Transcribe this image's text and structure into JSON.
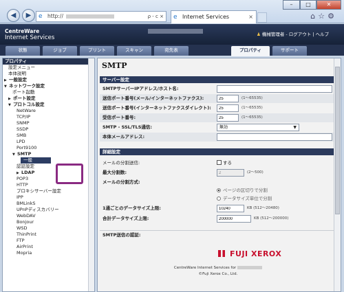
{
  "browser": {
    "url_prefix": "http://",
    "tab_title": "Internet Services",
    "tab_close": "×",
    "addr_tools": "ρ - c ×",
    "window_controls": [
      "–",
      "□",
      "✕"
    ]
  },
  "header": {
    "brand_line1": "CentreWare",
    "brand_line2": "Internet Services",
    "user_text": "機械管理者 - ログアウト | ヘルプ"
  },
  "nav_tabs": [
    {
      "label": "状態"
    },
    {
      "label": "ジョブ"
    },
    {
      "label": "プリント"
    },
    {
      "label": "スキャン"
    },
    {
      "label": "宛先表"
    },
    {
      "label": "プロパティ"
    },
    {
      "label": "サポート"
    }
  ],
  "sidebar": {
    "header": "プロパティ",
    "items": [
      {
        "label": "設定メニュー",
        "tri": ""
      },
      {
        "label": "本体説明",
        "tri": ""
      },
      {
        "label": "一般設定",
        "tri": "▶"
      },
      {
        "label": "ネットワーク設定",
        "tri": "▼"
      },
      {
        "label": "ポート起動",
        "tri": ""
      },
      {
        "label": "ポート設定",
        "tri": "▶"
      },
      {
        "label": "プロトコル設定",
        "tri": "▼"
      },
      {
        "label": "NetWare",
        "tri": ""
      },
      {
        "label": "TCP/IP",
        "tri": ""
      },
      {
        "label": "SNMP",
        "tri": ""
      },
      {
        "label": "SSDP",
        "tri": ""
      },
      {
        "label": "SMB",
        "tri": ""
      },
      {
        "label": "LPD",
        "tri": ""
      },
      {
        "label": "Port9100",
        "tri": ""
      },
      {
        "label": "SMTP",
        "tri": "▼"
      },
      {
        "label": "一般",
        "tri": ""
      },
      {
        "label": "認証設定",
        "tri": ""
      },
      {
        "label": "LDAP",
        "tri": "▶"
      },
      {
        "label": "POP3",
        "tri": ""
      },
      {
        "label": "HTTP",
        "tri": ""
      },
      {
        "label": "プロキシサーバー設定",
        "tri": ""
      },
      {
        "label": "IPP",
        "tri": ""
      },
      {
        "label": "BMLinkS",
        "tri": ""
      },
      {
        "label": "UPnPディスカバリー",
        "tri": ""
      },
      {
        "label": "WebDAV",
        "tri": ""
      },
      {
        "label": "Bonjour",
        "tri": ""
      },
      {
        "label": "WSD",
        "tri": ""
      },
      {
        "label": "ThinPrint",
        "tri": ""
      },
      {
        "label": "FTP",
        "tri": ""
      },
      {
        "label": "AirPrint",
        "tri": ""
      },
      {
        "label": "Mopria",
        "tri": ""
      }
    ]
  },
  "content": {
    "title": "SMTP",
    "server_section": {
      "header": "サーバー設定",
      "server_name_label": "SMTPサーバーIPアドレス/ホスト名:",
      "server_name_value": "",
      "fax_port_label": "送信ポート番号(メール/インターネットファクス):",
      "fax_port_value": "25",
      "fax_port_hint": "(1〜65535)",
      "direct_port_label": "送信ポート番号(インターネットファクスダイレクト):",
      "direct_port_value": "25",
      "direct_port_hint": "(1〜65535)",
      "recv_port_label": "受信ポート番号:",
      "recv_port_value": "25",
      "recv_port_hint": "(1〜65535)",
      "ssl_label": "SMTP - SSL/TLS通信:",
      "ssl_value": "無効",
      "email_label": "本体メールアドレス:",
      "email_value": ""
    },
    "detail_section": {
      "header": "詳細設定",
      "split_label": "メールの分割送信:",
      "split_checkbox": "する",
      "max_split_label": "最大分割数:",
      "max_split_value": "2",
      "max_split_hint": "(2〜500)",
      "split_method_label": "メールの分割方式:",
      "radio_page": "ページの区切りで分割",
      "radio_size": "データサイズ単位で分割",
      "per_mail_label": "1通ごとのデータサイズ上限:",
      "per_mail_value": "10240",
      "per_mail_hint": "KB (512〜20480)",
      "total_label": "合計データサイズ上限:",
      "total_value": "200000",
      "total_hint": "KB (512〜200000)"
    },
    "auth_section_label": "SMTP送信の認証:",
    "footer_logo": "FUJI XEROX",
    "footer_line1": "CentreWare Internet Services for",
    "footer_line2": "©Fuji Xerox Co., Ltd."
  }
}
